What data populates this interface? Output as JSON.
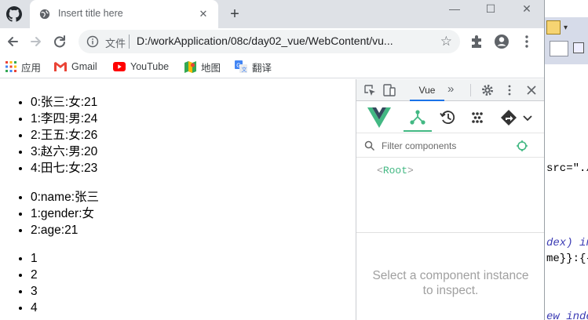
{
  "browser": {
    "tab_title": "Insert title here",
    "tab_close": "✕",
    "new_tab": "+",
    "window_controls": [
      "—",
      "☐",
      "✕"
    ],
    "omnibox_label": "文件",
    "url": "D:/workApplication/08c/day02_vue/WebContent/vu...",
    "bookmarks": [
      "应用",
      "Gmail",
      "YouTube",
      "地图",
      "翻译"
    ]
  },
  "page": {
    "list_students": [
      "0:张三:女:21",
      "1:李四:男:24",
      "2:王五:女:26",
      "3:赵六:男:20",
      "4:田七:女:23"
    ],
    "list_object": [
      "0:name:张三",
      "1:gender:女",
      "2:age:21"
    ],
    "list_numbers": [
      "1",
      "2",
      "3",
      "4"
    ]
  },
  "devtools": {
    "active_tab": "Vue",
    "more_tabs": "»",
    "filter_placeholder": "Filter components",
    "root_label": "Root",
    "inspect_message_line1": "Select a component instance",
    "inspect_message_line2": "to inspect.",
    "accent": "#42b883"
  },
  "ide": {
    "lines": [
      "src=\"./",
      "dex) in",
      "me}}:{{",
      "ew_inde"
    ]
  }
}
